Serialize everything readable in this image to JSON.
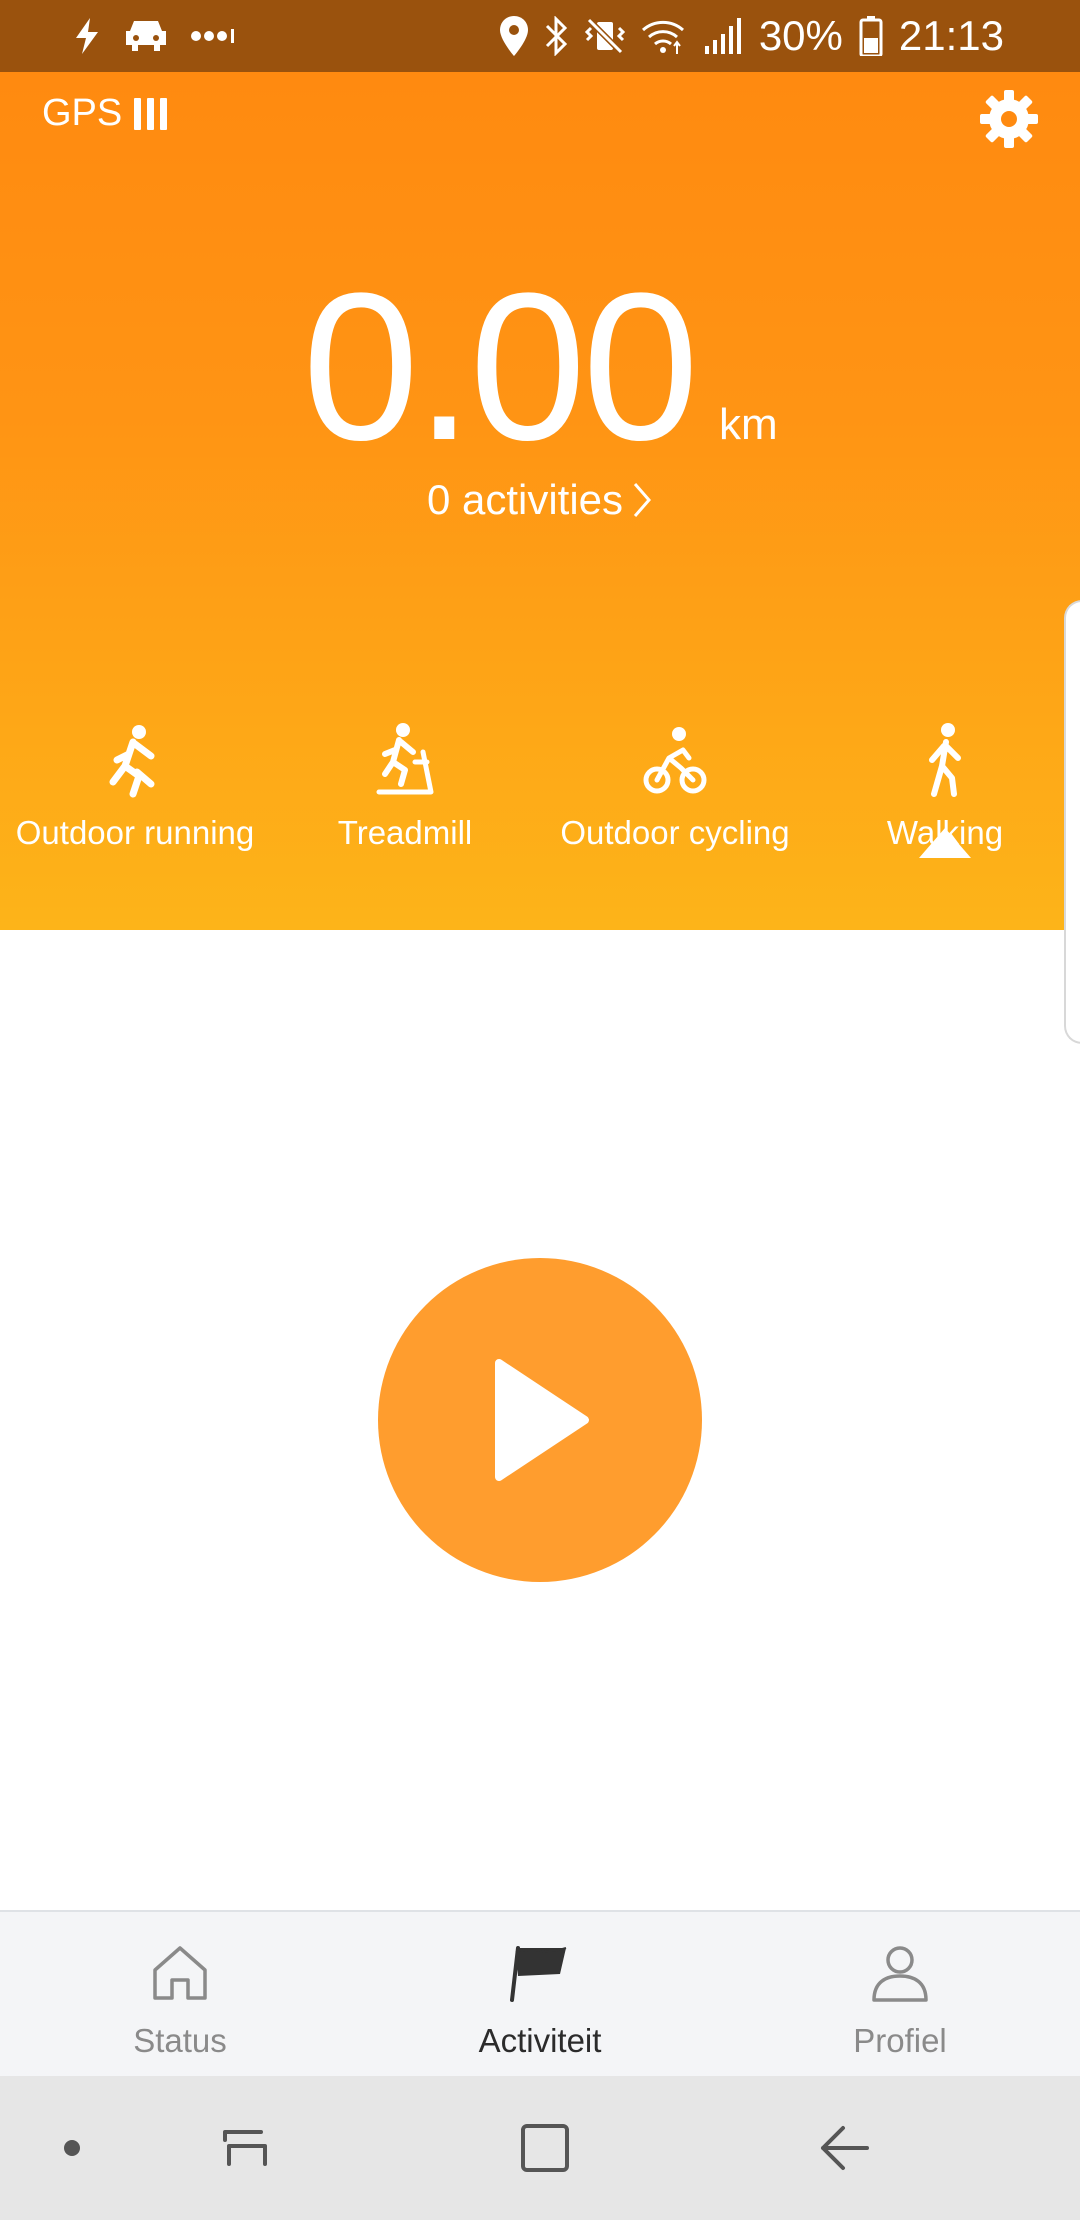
{
  "status_bar": {
    "battery_percent": "30%",
    "time": "21:13",
    "left_icons": [
      "flash-icon",
      "car-icon",
      "more-dots-icon"
    ],
    "right_icons": [
      "location-icon",
      "bluetooth-icon",
      "vibrate-mute-icon",
      "wifi-icon",
      "signal-icon",
      "battery-icon"
    ]
  },
  "header": {
    "gps_label": "GPS",
    "gps_signal_bars": 3,
    "distance_value": "0.00",
    "distance_unit": "km",
    "activities_label": "0 activities",
    "background_colors": [
      "#ff8a10",
      "#fdb419"
    ]
  },
  "modes": [
    {
      "label": "Outdoor running",
      "icon": "running-icon",
      "selected": false
    },
    {
      "label": "Treadmill",
      "icon": "treadmill-icon",
      "selected": false
    },
    {
      "label": "Outdoor cycling",
      "icon": "cycling-icon",
      "selected": false
    },
    {
      "label": "Walking",
      "icon": "walking-icon",
      "selected": true
    }
  ],
  "play_button": {
    "icon": "play-icon",
    "color": "#ff9d2e"
  },
  "bottom_nav": [
    {
      "label": "Status",
      "icon": "home-icon",
      "active": false
    },
    {
      "label": "Activiteit",
      "icon": "flag-icon",
      "active": true
    },
    {
      "label": "Profiel",
      "icon": "person-icon",
      "active": false
    }
  ],
  "system_nav": [
    "dot-icon",
    "recents-icon",
    "home-square-icon",
    "back-icon"
  ]
}
